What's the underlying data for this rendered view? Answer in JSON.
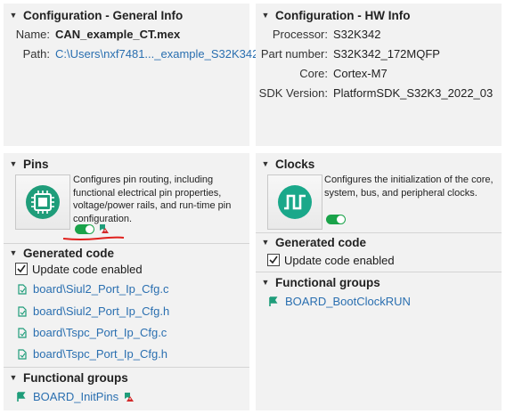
{
  "general": {
    "title": "Configuration - General Info",
    "name_label": "Name:",
    "name_value": "CAN_example_CT.mex",
    "path_label": "Path:",
    "path_value": "C:\\Users\\nxf7481..._example_S32K342"
  },
  "hw": {
    "title": "Configuration - HW Info",
    "processor_label": "Processor:",
    "processor_value": "S32K342",
    "part_label": "Part number:",
    "part_value": "S32K342_172MQFP",
    "core_label": "Core:",
    "core_value": "Cortex-M7",
    "sdk_label": "SDK Version:",
    "sdk_value": "PlatformSDK_S32K3_2022_03"
  },
  "pins": {
    "title": "Pins",
    "description_lines": [
      "Configures pin routing, including",
      "functional  electrical pin properties,",
      "voltage/power rails, and run-time pin",
      "configuration."
    ],
    "generated_title": "Generated code",
    "update_label": "Update code enabled",
    "files": [
      "board\\Siul2_Port_Ip_Cfg.c",
      "board\\Siul2_Port_Ip_Cfg.h",
      "board\\Tspc_Port_Ip_Cfg.c",
      "board\\Tspc_Port_Ip_Cfg.h"
    ],
    "functional_title": "Functional groups",
    "functional_item": "BOARD_InitPins"
  },
  "clocks": {
    "title": "Clocks",
    "description_lines": [
      "Configures the initialization of the core,",
      "system, bus, and peripheral clocks."
    ],
    "generated_title": "Generated code",
    "update_label": "Update code enabled",
    "functional_title": "Functional groups",
    "functional_item": "BOARD_BootClockRUN"
  },
  "colors": {
    "panel_bg": "#f2f2f2",
    "link": "#2a6fb0",
    "toggle_on": "#1aa34a",
    "pins_icon": "#1f9d7a",
    "clocks_icon": "#1aa88a",
    "annotation": "#e0201c"
  }
}
